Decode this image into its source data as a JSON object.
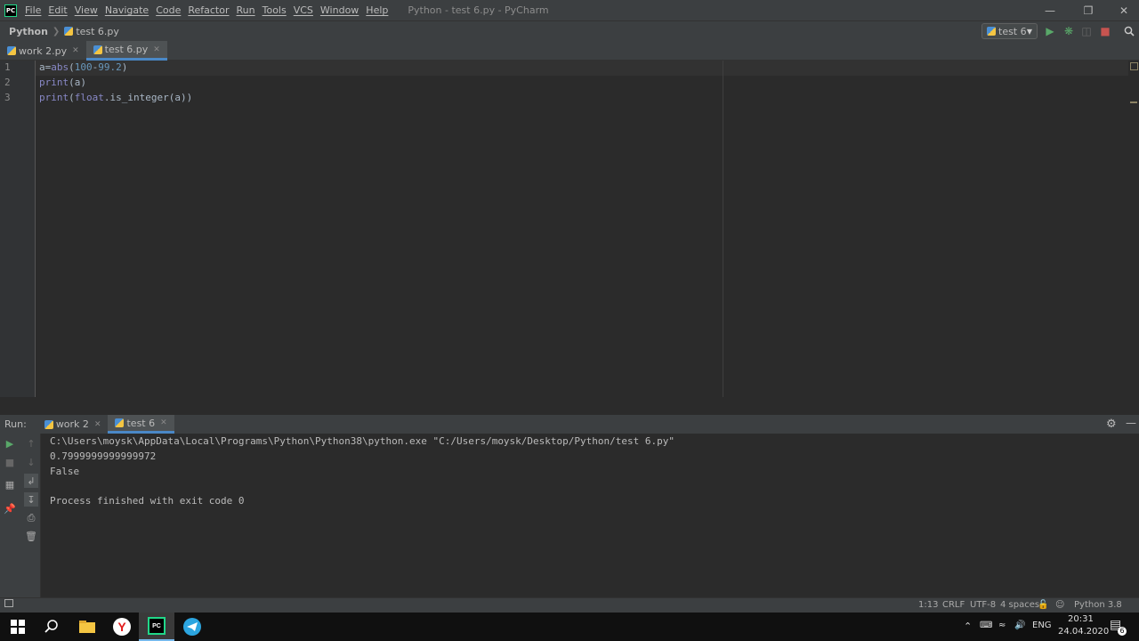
{
  "menubar": {
    "logo": "PC",
    "items": [
      "File",
      "Edit",
      "View",
      "Navigate",
      "Code",
      "Refactor",
      "Run",
      "Tools",
      "VCS",
      "Window",
      "Help"
    ],
    "window_title": "Python - test 6.py - PyCharm"
  },
  "navbar": {
    "project": "Python",
    "file": "test 6.py",
    "run_config": "test 6"
  },
  "editor_tabs": [
    {
      "label": "work 2.py",
      "active": false
    },
    {
      "label": "test 6.py",
      "active": true
    }
  ],
  "editor": {
    "line_numbers": [
      "1",
      "2",
      "3"
    ],
    "line1": {
      "a": "a",
      "eq": "=",
      "fn": "abs",
      "open": "(",
      "n1": "100",
      "minus": "-",
      "n2": "99.2",
      "close": ")"
    },
    "line2": {
      "fn": "print",
      "rest": "(a)"
    },
    "line3": {
      "fn": "print",
      "open": "(",
      "type": "float",
      "rest": ".is_integer(a))"
    }
  },
  "run_panel": {
    "label": "Run:",
    "tabs": [
      {
        "label": "work 2",
        "active": false
      },
      {
        "label": "test 6",
        "active": true
      }
    ],
    "console": [
      "C:\\Users\\moysk\\AppData\\Local\\Programs\\Python\\Python38\\python.exe \"C:/Users/moysk/Desktop/Python/test 6.py\"",
      "0.7999999999999972",
      "False",
      "",
      "Process finished with exit code 0"
    ]
  },
  "statusbar": {
    "position": "1:13",
    "line_sep": "CRLF",
    "encoding": "UTF-8",
    "indent": "4 spaces",
    "interpreter": "Python 3.8"
  },
  "taskbar": {
    "lang": "ENG",
    "time": "20:31",
    "date": "24.04.2020",
    "notification_count": "6"
  },
  "colors": {
    "accent_blue": "#4a88c7",
    "run_green": "#59a869",
    "stop_red": "#c75450",
    "builtin": "#8888c6",
    "number": "#6897bb"
  }
}
